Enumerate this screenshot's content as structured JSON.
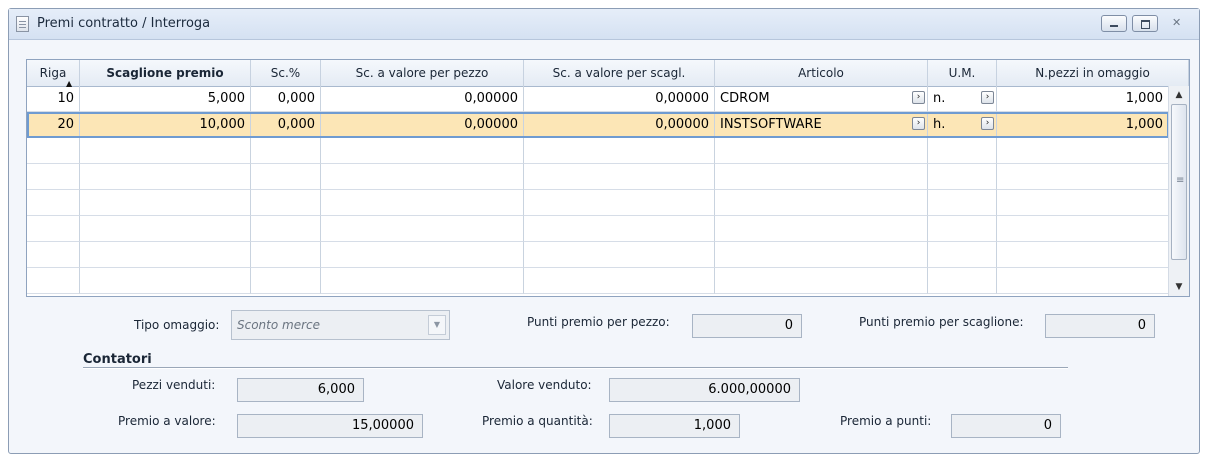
{
  "window": {
    "title": "Premi contratto / Interroga"
  },
  "grid": {
    "columns": [
      "Riga",
      "Scaglione premio",
      "Sc.%",
      "Sc. a valore per pezzo",
      "Sc. a valore per scagl.",
      "Articolo",
      "U.M.",
      "N.pezzi in omaggio"
    ],
    "rows": [
      {
        "riga": "10",
        "scaglione": "5,000",
        "sc_perc": "0,000",
        "sc_pezzo": "0,00000",
        "sc_scagl": "0,00000",
        "articolo": "CDROM",
        "um": "n.",
        "pezzi_omaggio": "1,000"
      },
      {
        "riga": "20",
        "scaglione": "10,000",
        "sc_perc": "0,000",
        "sc_pezzo": "0,00000",
        "sc_scagl": "0,00000",
        "articolo": "INSTSOFTWARE",
        "um": "h.",
        "pezzi_omaggio": "1,000"
      }
    ],
    "selected_row": 1
  },
  "form": {
    "tipo_omaggio": {
      "label": "Tipo omaggio:",
      "value": "Sconto merce"
    },
    "punti_pezzo": {
      "label": "Punti premio per pezzo:",
      "value": "0"
    },
    "punti_scaglione": {
      "label": "Punti premio per scaglione:",
      "value": "0"
    },
    "contatori_title": "Contatori",
    "pezzi_venduti": {
      "label": "Pezzi venduti:",
      "value": "6,000"
    },
    "valore_venduto": {
      "label": "Valore venduto:",
      "value": "6.000,00000"
    },
    "premio_valore": {
      "label": "Premio a valore:",
      "value": "15,00000"
    },
    "premio_quantita": {
      "label": "Premio a quantità:",
      "value": "1,000"
    },
    "premio_punti": {
      "label": "Premio a punti:",
      "value": "0"
    }
  },
  "icons": {
    "app": "document-icon",
    "zoom": "zoom-arrow-icon",
    "sort": "sort-arrow-icon"
  }
}
